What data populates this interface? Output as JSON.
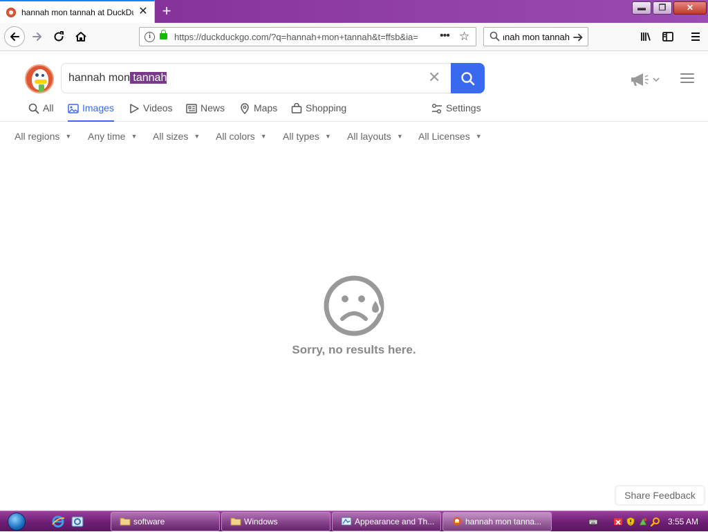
{
  "browser": {
    "tab_title": "hannah mon tannah at DuckDuckGo",
    "new_tab": "+",
    "close_tab": "✕",
    "url": "https://duckduckgo.com/?q=hannah+mon+tannah&t=ffsb&ia=images",
    "page_actions": "•••",
    "bookmark_star": "☆",
    "search_box_text": "hannah mon tannah",
    "window_buttons": {
      "minimize": "▬",
      "maximize": "❐",
      "close": "✕"
    }
  },
  "ddg": {
    "query_prefix": "hannah mon",
    "query_selected": " tannah",
    "clear": "✕",
    "tabs": {
      "all": "All",
      "images": "Images",
      "videos": "Videos",
      "news": "News",
      "maps": "Maps",
      "shopping": "Shopping",
      "settings": "Settings"
    },
    "active_tab": "Images",
    "filters": {
      "regions": "All regions",
      "time": "Any time",
      "sizes": "All sizes",
      "colors": "All colors",
      "types": "All types",
      "layouts": "All layouts",
      "licenses": "All Licenses"
    },
    "caret": "▼",
    "no_results": "Sorry, no results here.",
    "share_feedback": "Share Feedback"
  },
  "taskbar": {
    "items": {
      "software": "software",
      "windows": "Windows",
      "appearance": "Appearance and Th...",
      "firefox": "hannah mon tanna..."
    },
    "clock": "3:55 AM"
  },
  "colors": {
    "accent": "#3969ef",
    "ddg_orange": "#de5833",
    "titlebar_purple": "#8c3aa1",
    "selection": "#7a3a8c"
  }
}
